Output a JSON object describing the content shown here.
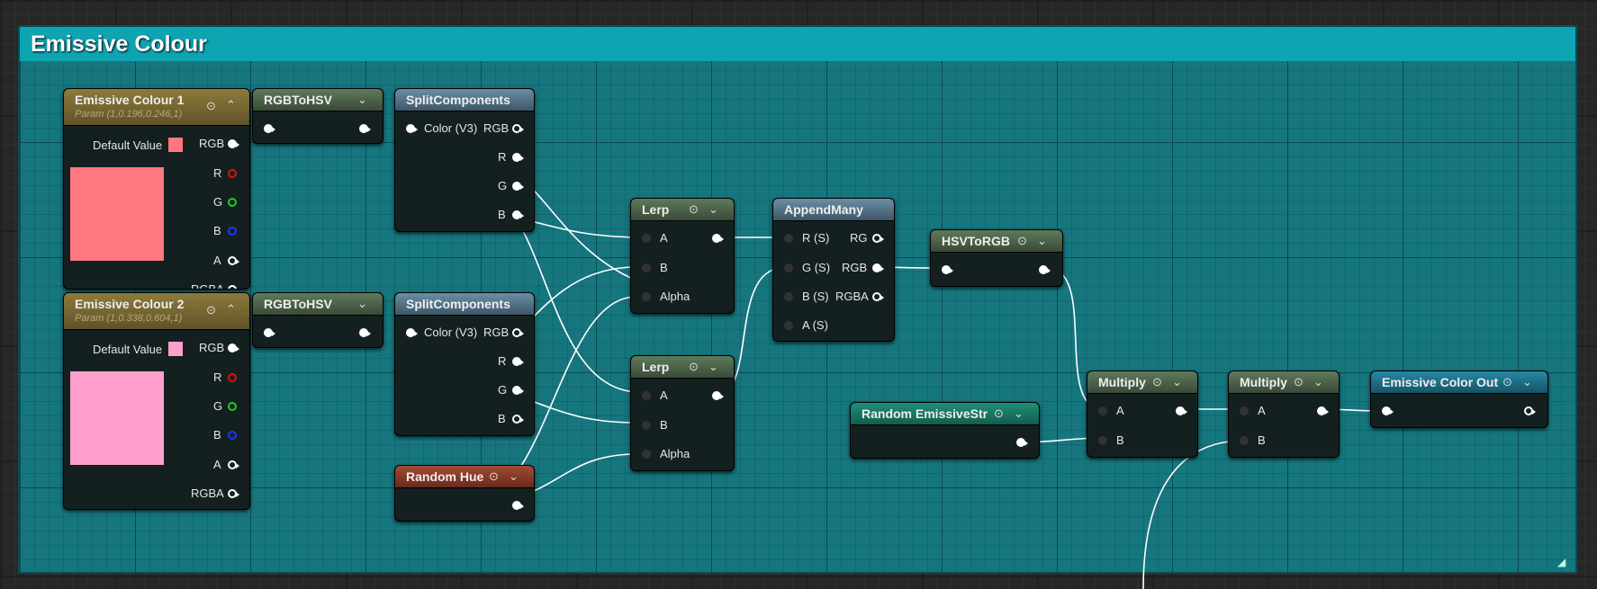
{
  "comment": {
    "title": "Emissive Colour"
  },
  "nodes": {
    "emissive1": {
      "title": "Emissive Colour 1",
      "subtitle": "Param (1,0.196,0.246,1)",
      "default_label": "Default Value",
      "color": "#ff7880",
      "pins": [
        "RGB",
        "R",
        "G",
        "B",
        "A",
        "RGBA"
      ]
    },
    "emissive2": {
      "title": "Emissive Colour 2",
      "subtitle": "Param (1,0.338,0.604,1)",
      "default_label": "Default Value",
      "color": "#ff9fcd",
      "pins": [
        "RGB",
        "R",
        "G",
        "B",
        "A",
        "RGBA"
      ]
    },
    "rgbtohsv1": {
      "title": "RGBToHSV"
    },
    "rgbtohsv2": {
      "title": "RGBToHSV"
    },
    "split1": {
      "title": "SplitComponents",
      "pins": [
        "Color (V3)",
        "RGB",
        "R",
        "G",
        "B"
      ]
    },
    "split2": {
      "title": "SplitComponents",
      "pins": [
        "Color (V3)",
        "RGB",
        "R",
        "G",
        "B"
      ]
    },
    "random_hue": {
      "title": "Random Hue"
    },
    "lerp1": {
      "title": "Lerp",
      "pins": [
        "A",
        "B",
        "Alpha"
      ]
    },
    "lerp2": {
      "title": "Lerp",
      "pins": [
        "A",
        "B",
        "Alpha"
      ]
    },
    "appendmany": {
      "title": "AppendMany",
      "pins": [
        "R (S)",
        "G (S)",
        "B (S)",
        "A (S)",
        "RG",
        "RGB",
        "RGBA"
      ]
    },
    "hsvtorgb": {
      "title": "HSVToRGB"
    },
    "random_emissive": {
      "title": "Random EmissiveStr"
    },
    "multiply1": {
      "title": "Multiply",
      "pins": [
        "A",
        "B"
      ]
    },
    "multiply2": {
      "title": "Multiply",
      "pins": [
        "A",
        "B"
      ]
    },
    "emissive_out": {
      "title": "Emissive Color Out"
    }
  },
  "icons": {
    "preview": "circle-arrow-icon",
    "collapse": "chevron-up-icon",
    "expand": "chevron-down-icon",
    "resize": "resize-grip-icon"
  }
}
